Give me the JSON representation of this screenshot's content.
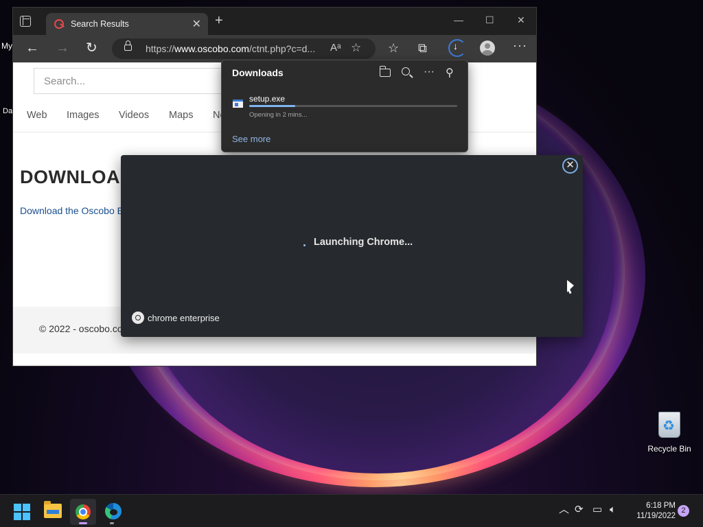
{
  "desktop": {
    "stray_text_top": "My",
    "stray_text_mid": "Da",
    "recycle_bin_label": "Recycle Bin"
  },
  "browser": {
    "tab_title": "Search Results",
    "tab_close": "✕",
    "new_tab": "+",
    "url_prefix": "https://",
    "url_host": "www.oscobo.com",
    "url_path": "/ctnt.php?c=d...",
    "page": {
      "search_placeholder": "Search...",
      "nav": [
        "Web",
        "Images",
        "Videos",
        "Maps",
        "Ne"
      ],
      "heading": "DOWNLOA",
      "link": "Download the Oscobo E",
      "footer": "© 2022 - oscobo.co"
    }
  },
  "downloads": {
    "title": "Downloads",
    "file_name": "setup.exe",
    "status": "Opening in 2 mins...",
    "progress": 0.22,
    "see_more": "See more"
  },
  "launch_dialog": {
    "message": "Launching Chrome...",
    "brand": "chrome enterprise",
    "close": "✕"
  },
  "taskbar": {
    "time": "6:18 PM",
    "date": "11/19/2022",
    "notification_count": "2"
  },
  "colors": {
    "accent_blue": "#3e7bd6",
    "progress": "#7fb5f0",
    "dialog_bg": "#26292d"
  }
}
